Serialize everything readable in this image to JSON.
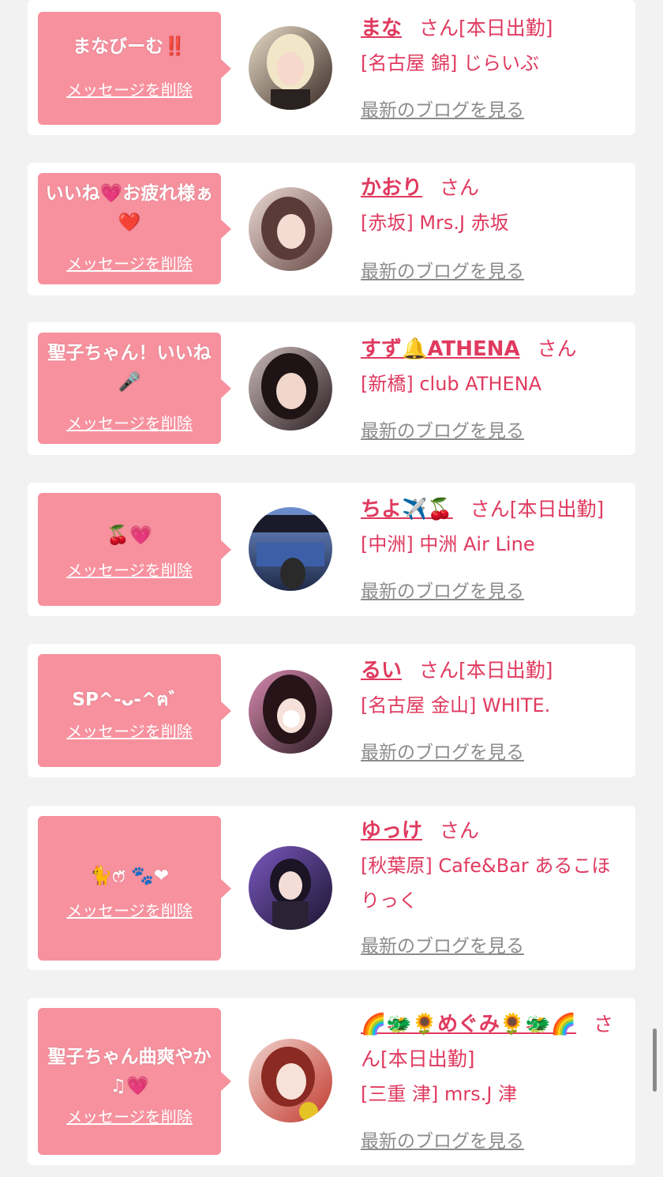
{
  "delete_label": "メッセージを削除",
  "blog_label": "最新のブログを見る",
  "san_suffix": "さん",
  "cards": [
    {
      "message": "まなびーむ‼️",
      "name": "まな",
      "status": "[本日出勤]",
      "shop": "[名古屋 錦] じらいぶ",
      "avatar": {
        "bg1": "#e8dcc8",
        "bg2": "#3a2a25",
        "hair": "#f1e6c8"
      }
    },
    {
      "message": "いいね💗お疲れ様ぁ❤️",
      "name": "かおり",
      "status": "",
      "shop": "[赤坂] Mrs.J 赤坂",
      "avatar": {
        "bg1": "#e9d9d4",
        "bg2": "#6a4a46",
        "hair": "#5b3b37"
      }
    },
    {
      "message": "聖子ちゃん！いいね🎤",
      "name": "すず🔔ATHENA",
      "status": "",
      "shop": "[新橋] club ATHENA",
      "avatar": {
        "bg1": "#c9b9b9",
        "bg2": "#2a1e22",
        "hair": "#1e1416"
      }
    },
    {
      "message": "🍒💗",
      "name": "ちよ✈️🍒",
      "status": "[本日出勤]",
      "shop": "[中洲] 中洲 Air Line",
      "avatar": {
        "bg1": "#6f8fd0",
        "bg2": "#1f2a48",
        "hair": "#2a2a2a"
      }
    },
    {
      "message": "SP^-ᴗ-^ฅ゛",
      "name": "るい",
      "status": "[本日出勤]",
      "shop": "[名古屋 金山] WHITE.",
      "avatar": {
        "bg1": "#d88ab0",
        "bg2": "#2b1b22",
        "hair": "#261419"
      }
    },
    {
      "message": "🐈ෆ̈ 🐾❤",
      "name": "ゆっけ",
      "status": "",
      "shop": "[秋葉原] Cafe&Bar あるこほりっく",
      "avatar": {
        "bg1": "#7a58c0",
        "bg2": "#1c1530",
        "hair": "#1a1424"
      }
    },
    {
      "message": "聖子ちゃん曲爽やか♫💗",
      "name": "🌈🐲🌻めぐみ🌻🐲🌈",
      "status": "[本日出勤]",
      "shop": "[三重 津] mrs.J 津",
      "avatar": {
        "bg1": "#f0d3cd",
        "bg2": "#c23a2f",
        "hair": "#8a2a22"
      }
    }
  ]
}
